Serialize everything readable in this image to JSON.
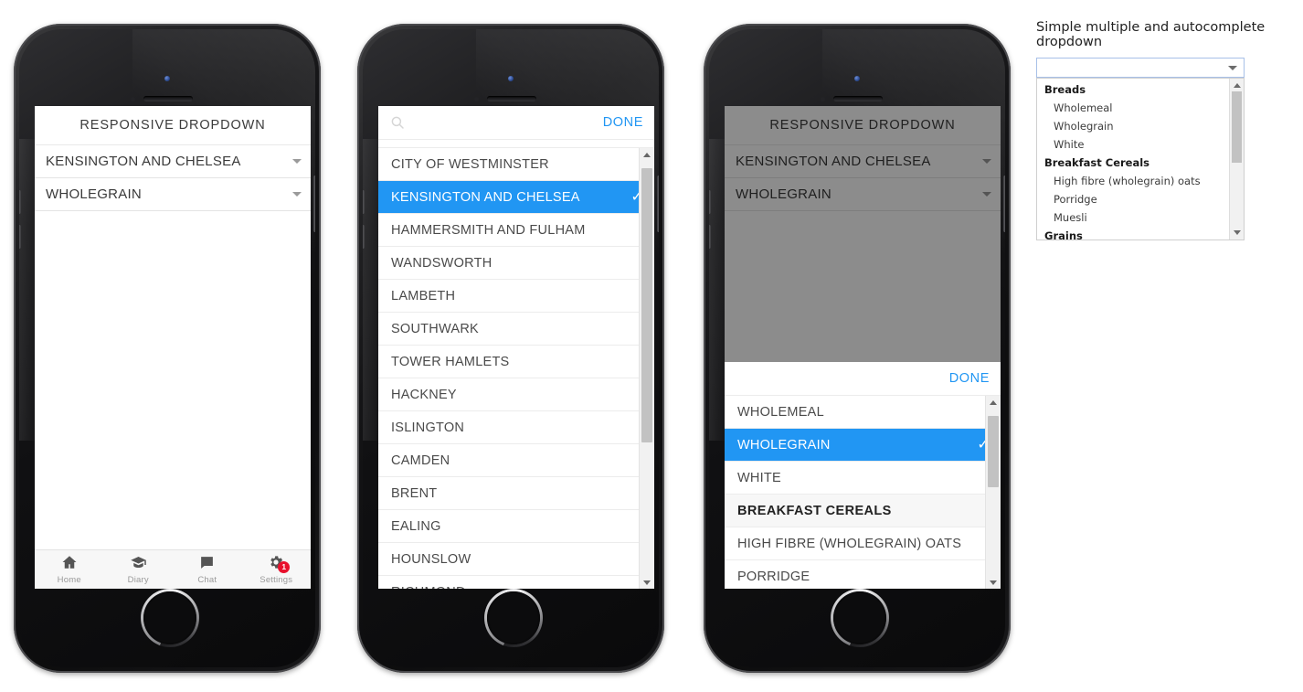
{
  "app": {
    "title": "RESPONSIVE DROPDOWN",
    "selects": [
      {
        "value": "KENSINGTON AND CHELSEA",
        "icon": "chevron-down-icon"
      },
      {
        "value": "WHOLEGRAIN",
        "icon": "chevron-down-icon"
      }
    ],
    "tabbar": [
      {
        "label": "Home",
        "icon": "home-icon",
        "badge": ""
      },
      {
        "label": "Diary",
        "icon": "graduation-cap-icon",
        "badge": ""
      },
      {
        "label": "Chat",
        "icon": "chat-bubble-icon",
        "badge": ""
      },
      {
        "label": "Settings",
        "icon": "gear-icon",
        "badge": "1"
      }
    ]
  },
  "picker_boroughs": {
    "search_icon": "search-icon",
    "search_placeholder": "",
    "done_label": "DONE",
    "items": [
      {
        "label": "CITY OF WESTMINSTER",
        "selected": false,
        "group": false
      },
      {
        "label": "KENSINGTON AND CHELSEA",
        "selected": true,
        "group": false
      },
      {
        "label": "HAMMERSMITH AND FULHAM",
        "selected": false,
        "group": false
      },
      {
        "label": "WANDSWORTH",
        "selected": false,
        "group": false
      },
      {
        "label": "LAMBETH",
        "selected": false,
        "group": false
      },
      {
        "label": "SOUTHWARK",
        "selected": false,
        "group": false
      },
      {
        "label": "TOWER HAMLETS",
        "selected": false,
        "group": false
      },
      {
        "label": "HACKNEY",
        "selected": false,
        "group": false
      },
      {
        "label": "ISLINGTON",
        "selected": false,
        "group": false
      },
      {
        "label": "CAMDEN",
        "selected": false,
        "group": false
      },
      {
        "label": "BRENT",
        "selected": false,
        "group": false
      },
      {
        "label": "EALING",
        "selected": false,
        "group": false
      },
      {
        "label": "HOUNSLOW",
        "selected": false,
        "group": false
      },
      {
        "label": "RICHMOND",
        "selected": false,
        "group": false
      }
    ]
  },
  "picker_foods": {
    "done_label": "DONE",
    "items": [
      {
        "label": "WHOLEMEAL",
        "selected": false,
        "group": false
      },
      {
        "label": "WHOLEGRAIN",
        "selected": true,
        "group": false
      },
      {
        "label": "WHITE",
        "selected": false,
        "group": false
      },
      {
        "label": "BREAKFAST CEREALS",
        "selected": false,
        "group": true
      },
      {
        "label": "HIGH FIBRE (WHOLEGRAIN) OATS",
        "selected": false,
        "group": false
      },
      {
        "label": "PORRIDGE",
        "selected": false,
        "group": false
      }
    ]
  },
  "panel": {
    "title": "Simple multiple and autocomplete dropdown",
    "combo_value": "",
    "combo_icon": "chevron-down-icon",
    "menu": [
      {
        "label": "Breads",
        "group": true
      },
      {
        "label": "Wholemeal",
        "group": false
      },
      {
        "label": "Wholegrain",
        "group": false
      },
      {
        "label": "White",
        "group": false
      },
      {
        "label": "Breakfast Cereals",
        "group": true
      },
      {
        "label": "High fibre (wholegrain) oats",
        "group": false
      },
      {
        "label": "Porridge",
        "group": false
      },
      {
        "label": "Muesli",
        "group": false
      },
      {
        "label": "Grains",
        "group": true
      }
    ]
  },
  "colors": {
    "accent": "#2196f3",
    "badge": "#e8112d",
    "combo_border": "#a8c0e8",
    "scroll_thumb": "#c2c2c2"
  }
}
